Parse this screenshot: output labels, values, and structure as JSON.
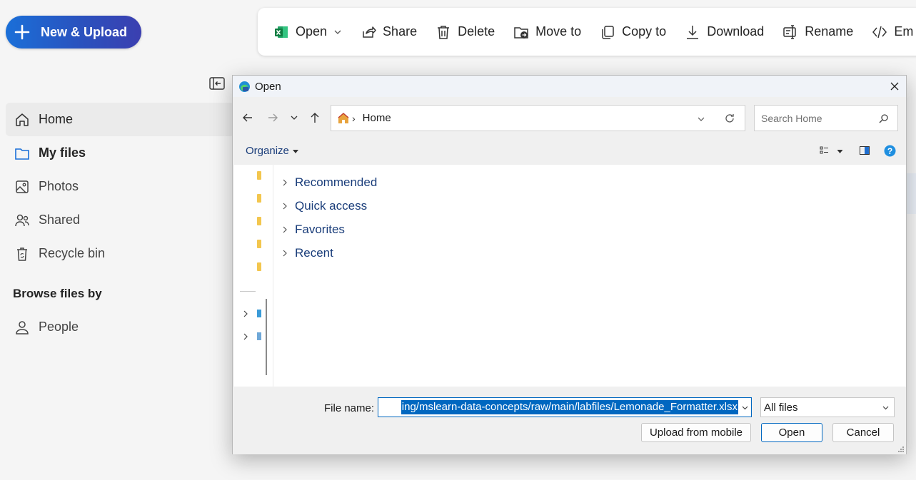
{
  "app": {
    "new_upload_label": "New & Upload",
    "commands": [
      {
        "label": "Open",
        "icon": "excel-icon"
      },
      {
        "label": "Share",
        "icon": "share-icon"
      },
      {
        "label": "Delete",
        "icon": "trash-icon"
      },
      {
        "label": "Move to",
        "icon": "move-to-icon"
      },
      {
        "label": "Copy to",
        "icon": "copy-icon"
      },
      {
        "label": "Download",
        "icon": "download-icon"
      },
      {
        "label": "Rename",
        "icon": "rename-icon"
      },
      {
        "label": "Em",
        "icon": "embed-icon"
      }
    ],
    "nav": [
      {
        "label": "Home",
        "icon": "home-icon"
      },
      {
        "label": "My files",
        "icon": "folder-icon"
      },
      {
        "label": "Photos",
        "icon": "photos-icon"
      },
      {
        "label": "Shared",
        "icon": "shared-icon"
      },
      {
        "label": "Recycle bin",
        "icon": "recycle-bin-icon"
      }
    ],
    "browse_heading": "Browse files by",
    "people_label": "People"
  },
  "dialog": {
    "title": "Open",
    "address": {
      "location": "Home"
    },
    "search_placeholder": "Search Home",
    "organize_label": "Organize",
    "tree": [
      "Recommended",
      "Quick access",
      "Favorites",
      "Recent"
    ],
    "file_name_label": "File name:",
    "file_name_value": "ing/mslearn-data-concepts/raw/main/labfiles/Lemonade_Formatter.xlsx",
    "file_type": "All files",
    "buttons": {
      "upload": "Upload from mobile",
      "open": "Open",
      "cancel": "Cancel"
    }
  },
  "colors": {
    "accent": "#0067c0",
    "new_button_start": "#1a6fd8",
    "new_button_end": "#3b3fb0",
    "tree_text": "#1a3d7a"
  }
}
